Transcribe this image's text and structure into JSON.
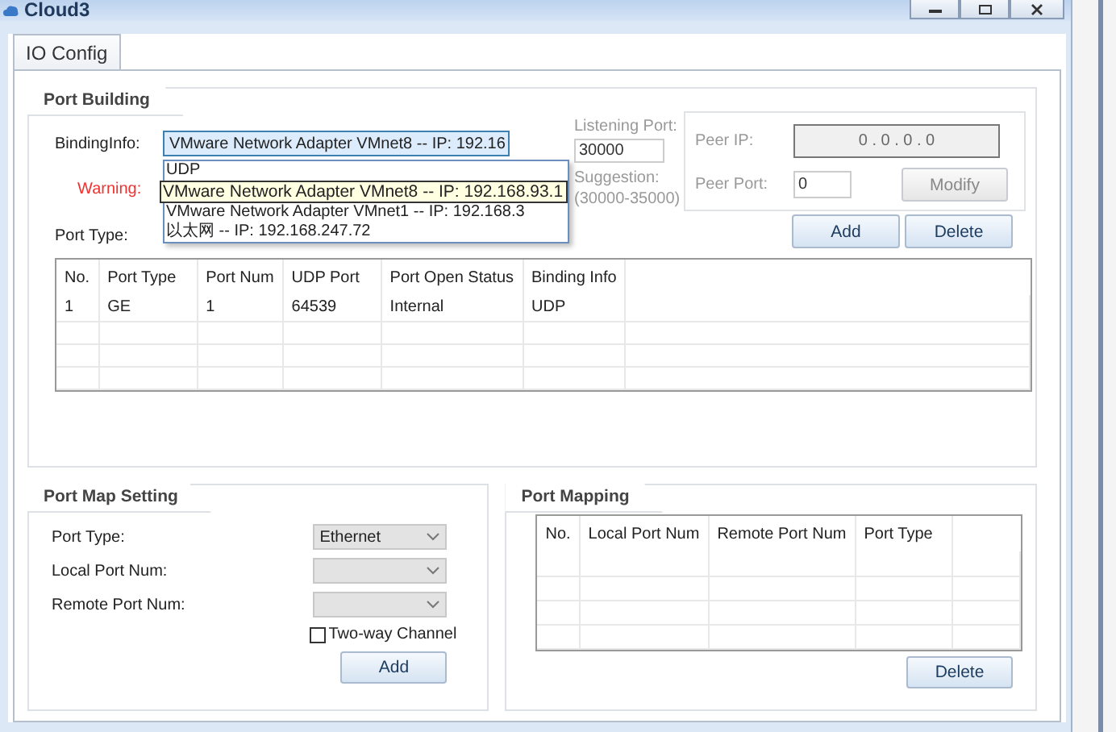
{
  "window": {
    "title": "Cloud3"
  },
  "tabs": [
    {
      "label": "IO Config",
      "selected": true
    }
  ],
  "port_building": {
    "title": "Port Building",
    "binding_label": "BindingInfo:",
    "binding_value": "VMware Network Adapter VMnet8 -- IP: 192.16",
    "dropdown": [
      {
        "kind": "option",
        "text": "UDP"
      },
      {
        "kind": "tooltip",
        "text": "VMware Network Adapter VMnet8 -- IP: 192.168.93.1"
      },
      {
        "kind": "option",
        "text": "VMware Network Adapter VMnet1 -- IP: 192.168.3"
      },
      {
        "kind": "option",
        "text": "以太网 -- IP: 192.168.247.72"
      }
    ],
    "warning_label": "Warning:",
    "port_type_label": "Port Type:",
    "listening_label": "Listening Port:",
    "listening_value": "30000",
    "suggestion_label": "Suggestion:",
    "suggestion_range": "(30000-35000)",
    "peer_ip_label": "Peer IP:",
    "peer_ip": "0 . 0 . 0 . 0",
    "peer_port_label": "Peer Port:",
    "peer_port": "0",
    "modify_button": {
      "label": "Modify",
      "disabled": true
    },
    "buttons": [
      "Add",
      "Delete"
    ],
    "table": {
      "columns": [
        "No.",
        "Port Type",
        "Port Num",
        "UDP Port",
        "Port Open Status",
        "Binding Info"
      ],
      "rows": [
        [
          "1",
          "GE",
          "1",
          "64539",
          "Internal",
          "UDP"
        ]
      ]
    }
  },
  "port_map_setting": {
    "title": "Port Map Setting",
    "fields": [
      {
        "label": "Port Type:",
        "value": "Ethernet"
      },
      {
        "label": "Local Port Num:"
      },
      {
        "label": "Remote Port Num:"
      }
    ],
    "two_way": {
      "label": "Two-way Channel",
      "checked": false
    },
    "add_button": "Add"
  },
  "port_mapping": {
    "title": "Port Mapping",
    "columns": [
      "No.",
      "Local Port Num",
      "Remote Port Num",
      "Port Type"
    ],
    "delete_button": "Delete"
  }
}
